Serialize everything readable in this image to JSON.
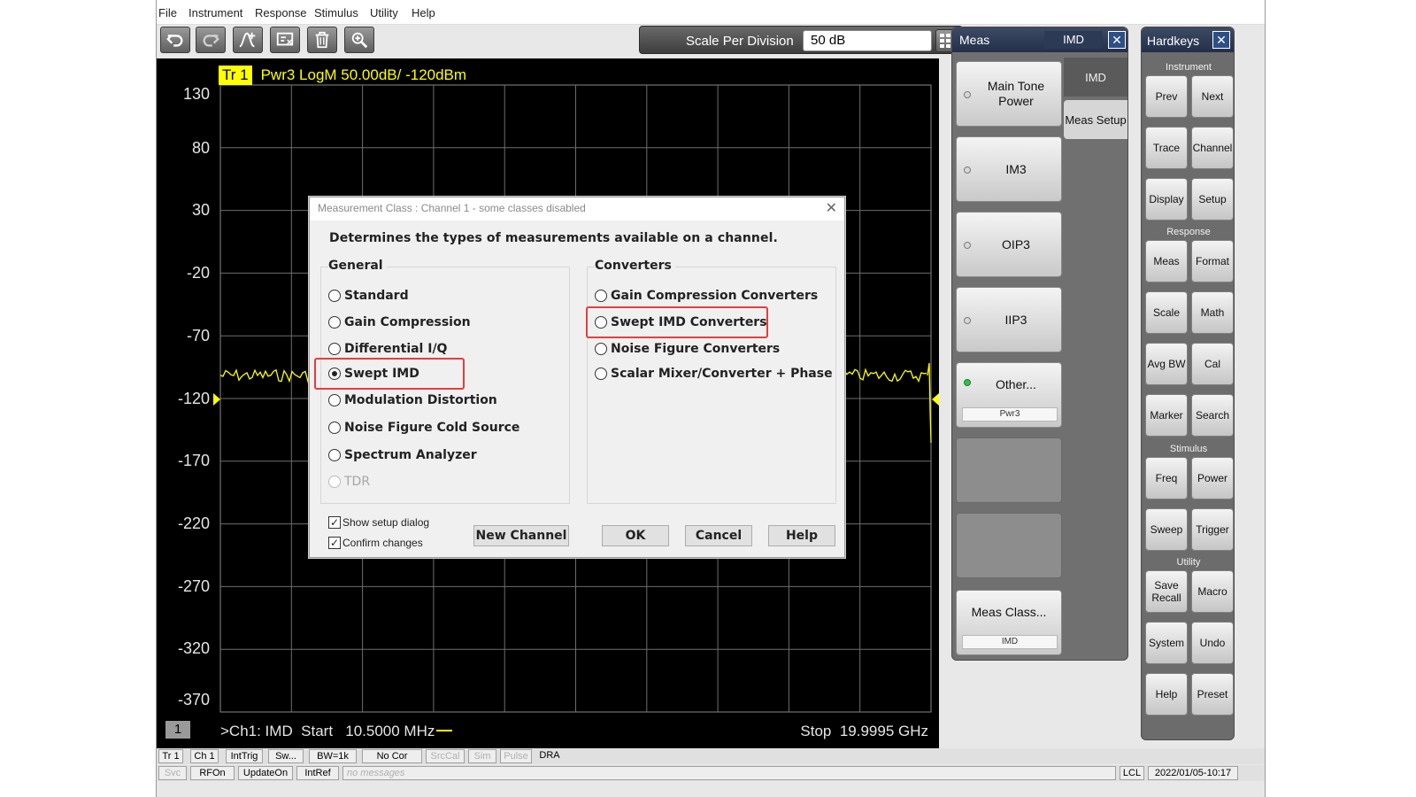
{
  "menu": [
    "File",
    "Instrument",
    "Response",
    "Stimulus",
    "Utility",
    "Help"
  ],
  "toolbar": {
    "buttons": [
      "undo-icon",
      "redo-icon",
      "marker-add-icon",
      "screenshot-icon",
      "trash-icon",
      "zoom-icon"
    ]
  },
  "scale": {
    "label": "Scale Per Division",
    "value": "50 dB"
  },
  "trace": {
    "tag": "Tr 1",
    "info": "Pwr3 LogM 50.00dB/  -120dBm"
  },
  "axis": {
    "y_ticks": [
      "130",
      "80",
      "30",
      "-20",
      "-70",
      "-120",
      "-170",
      "-220",
      "-270",
      "-320",
      "-370"
    ]
  },
  "channel": {
    "num": "1",
    "start_info": ">Ch1: IMD  Start   10.5000 MHz",
    "stop_info": "Stop  19.9995 GHz"
  },
  "status1": [
    "Tr 1",
    "Ch 1",
    "IntTrig",
    "Sw...",
    "BW=1k",
    "No Cor",
    "SrcCal",
    "Sim",
    "Pulse",
    "DRA"
  ],
  "status2": [
    "Svc",
    "RFOn",
    "UpdateOn",
    "IntRef",
    "no messages",
    "LCL",
    "2022/01/05-10:17"
  ],
  "meas_panel": {
    "title": "Meas",
    "mode": "IMD",
    "softkeys": [
      {
        "label": "Main Tone Power"
      },
      {
        "label": "IM3"
      },
      {
        "label": "OIP3"
      },
      {
        "label": "IIP3"
      },
      {
        "label": "Other...",
        "sub": "Pwr3"
      },
      {
        "label": "Meas Class...",
        "sub": "IMD"
      }
    ],
    "tabs": [
      "IMD",
      "Meas Setup"
    ]
  },
  "hardkeys": {
    "title": "Hardkeys",
    "groups": {
      "instrument": {
        "label": "Instrument",
        "keys": [
          "Prev",
          "Next",
          "Trace",
          "Channel",
          "Display",
          "Setup"
        ]
      },
      "response": {
        "label": "Response",
        "keys": [
          "Meas",
          "Format",
          "Scale",
          "Math",
          "Avg BW",
          "Cal",
          "Marker",
          "Search"
        ]
      },
      "stimulus": {
        "label": "Stimulus",
        "keys": [
          "Freq",
          "Power",
          "Sweep",
          "Trigger"
        ]
      },
      "utility": {
        "label": "Utility",
        "keys": [
          "Save Recall",
          "Macro",
          "System",
          "Undo",
          "Help",
          "Preset"
        ]
      }
    }
  },
  "dialog": {
    "title": "Measurement Class : Channel 1 - some classes disabled",
    "description": "Determines the types of measurements available on a channel.",
    "general": {
      "label": "General",
      "options": [
        "Standard",
        "Gain Compression",
        "Differential I/Q",
        "Swept IMD",
        "Modulation Distortion",
        "Noise Figure Cold Source",
        "Spectrum Analyzer",
        "TDR"
      ],
      "selected": "Swept IMD",
      "disabled": [
        "TDR"
      ]
    },
    "converters": {
      "label": "Converters",
      "options": [
        "Gain Compression Converters",
        "Swept IMD Converters",
        "Noise Figure Converters",
        "Scalar Mixer/Converter + Phase"
      ]
    },
    "checkboxes": [
      "Show setup dialog",
      "Confirm changes"
    ],
    "buttons": [
      "New Channel",
      "OK",
      "Cancel",
      "Help"
    ]
  },
  "colors": {
    "trace": "#ffff00",
    "plot_bg": "#000000",
    "highlight": "#e53d3d",
    "panel_header": "#2c3a55"
  }
}
